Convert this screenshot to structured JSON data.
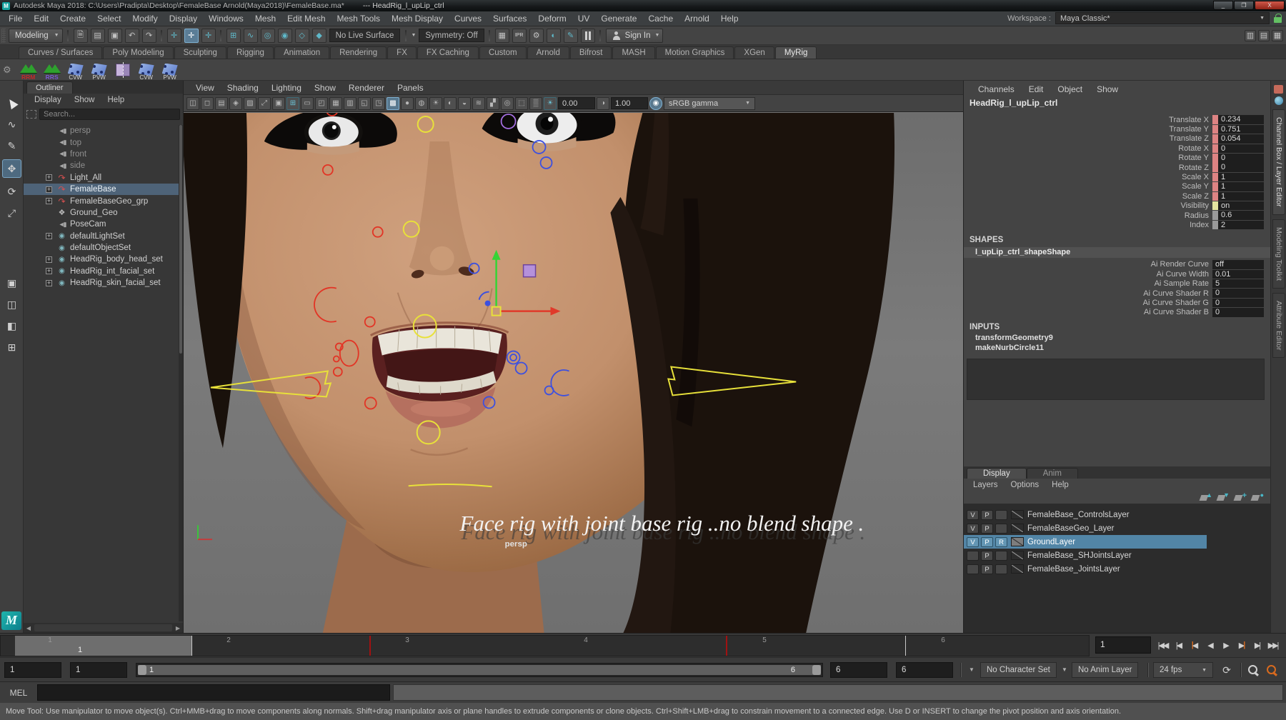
{
  "window": {
    "title": "Autodesk Maya 2018: C:\\Users\\Pradipta\\Desktop\\FemaleBase Arnold(Maya2018)\\FemaleBase.ma*",
    "title_extra": "---    HeadRig_l_upLip_ctrl",
    "buttons": {
      "minimize": "_",
      "restore": "❐",
      "close": "X"
    }
  },
  "menu_bar": {
    "items": [
      "File",
      "Edit",
      "Create",
      "Select",
      "Modify",
      "Display",
      "Windows",
      "Mesh",
      "Edit Mesh",
      "Mesh Tools",
      "Mesh Display",
      "Curves",
      "Surfaces",
      "Deform",
      "UV",
      "Generate",
      "Cache",
      "Arnold",
      "Help"
    ],
    "workspace_label": "Workspace :",
    "workspace_value": "Maya Classic*"
  },
  "status_line": {
    "menu_set": "Modeling",
    "live_surface": "No Live Surface",
    "symmetry": "Symmetry: Off",
    "ipr_label": "IPR",
    "sign_in": "Sign In"
  },
  "shelf": {
    "tabs": [
      "Curves / Surfaces",
      "Poly Modeling",
      "Sculpting",
      "Rigging",
      "Animation",
      "Rendering",
      "FX",
      "FX Caching",
      "Custom",
      "Arnold",
      "Bifrost",
      "MASH",
      "Motion Graphics",
      "XGen"
    ],
    "active_tab": "MyRig",
    "items": [
      {
        "label": "RRM"
      },
      {
        "label": "RRS"
      },
      {
        "label": "CVW"
      },
      {
        "label": "PVW"
      },
      {
        "label": ""
      },
      {
        "label": "CVW"
      },
      {
        "label": "PVW"
      }
    ]
  },
  "outliner": {
    "tab": "Outliner",
    "menus": [
      "Display",
      "Show",
      "Help"
    ],
    "search_placeholder": "Search...",
    "items": [
      {
        "label": "persp",
        "icon": "camera",
        "muted": true
      },
      {
        "label": "top",
        "icon": "camera",
        "muted": true
      },
      {
        "label": "front",
        "icon": "camera",
        "muted": true
      },
      {
        "label": "side",
        "icon": "camera",
        "muted": true
      },
      {
        "label": "Light_All",
        "icon": "transform",
        "expandable": true
      },
      {
        "label": "FemaleBase",
        "icon": "transform",
        "expandable": true,
        "selected": true
      },
      {
        "label": "FemaleBaseGeo_grp",
        "icon": "transform",
        "expandable": true
      },
      {
        "label": "Ground_Geo",
        "icon": "geo"
      },
      {
        "label": "PoseCam",
        "icon": "camera"
      },
      {
        "label": "defaultLightSet",
        "icon": "set",
        "expandable": true
      },
      {
        "label": "defaultObjectSet",
        "icon": "set"
      },
      {
        "label": "HeadRig_body_head_set",
        "icon": "set",
        "expandable": true
      },
      {
        "label": "HeadRig_int_facial_set",
        "icon": "set",
        "expandable": true
      },
      {
        "label": "HeadRig_skin_facial_set",
        "icon": "set",
        "expandable": true
      }
    ]
  },
  "viewport": {
    "menus": [
      "View",
      "Shading",
      "Lighting",
      "Show",
      "Renderer",
      "Panels"
    ],
    "exposure": "0.00",
    "gamma": "1.00",
    "color_transform": "sRGB gamma",
    "overlay_text": "Face rig  with joint base rig ..no blend shape .",
    "camera_label": "persp"
  },
  "channel_box": {
    "menus": [
      "Channels",
      "Edit",
      "Object",
      "Show"
    ],
    "object_name": "HeadRig_l_upLip_ctrl",
    "attributes": [
      {
        "label": "Translate X",
        "value": "0.234",
        "chip": "keyed"
      },
      {
        "label": "Translate Y",
        "value": "0.751",
        "chip": "keyed"
      },
      {
        "label": "Translate Z",
        "value": "0.054",
        "chip": "keyed"
      },
      {
        "label": "Rotate X",
        "value": "0",
        "chip": "keyed"
      },
      {
        "label": "Rotate Y",
        "value": "0",
        "chip": "keyed"
      },
      {
        "label": "Rotate Z",
        "value": "0",
        "chip": "keyed"
      },
      {
        "label": "Scale X",
        "value": "1",
        "chip": "keyed"
      },
      {
        "label": "Scale Y",
        "value": "1",
        "chip": "keyed"
      },
      {
        "label": "Scale Z",
        "value": "1",
        "chip": "keyed"
      },
      {
        "label": "Visibility",
        "value": "on",
        "chip": "vis"
      },
      {
        "label": "Radius",
        "value": "0.6",
        "chip": "plain"
      },
      {
        "label": "Index",
        "value": "2",
        "chip": "plain"
      }
    ],
    "shapes_header": "SHAPES",
    "shape_node": "l_upLip_ctrl_shapeShape",
    "shape_attributes": [
      {
        "label": "Ai Render Curve",
        "value": "off"
      },
      {
        "label": "Ai Curve Width",
        "value": "0.01"
      },
      {
        "label": "Ai Sample Rate",
        "value": "5"
      },
      {
        "label": "Ai Curve Shader R",
        "value": "0"
      },
      {
        "label": "Ai Curve Shader G",
        "value": "0"
      },
      {
        "label": "Ai Curve Shader B",
        "value": "0"
      }
    ],
    "inputs_header": "INPUTS",
    "inputs": [
      "transformGeometry9",
      "makeNurbCircle11"
    ]
  },
  "layer_editor": {
    "tabs": {
      "display": "Display",
      "anim": "Anim"
    },
    "menus": [
      "Layers",
      "Options",
      "Help"
    ],
    "layers": [
      {
        "v": "V",
        "p": "P",
        "r": "",
        "name": "FemaleBase_ControlsLayer",
        "swatch": "empty"
      },
      {
        "v": "V",
        "p": "P",
        "r": "",
        "name": "FemaleBaseGeo_Layer",
        "swatch": "empty"
      },
      {
        "v": "V",
        "p": "P",
        "r": "R",
        "name": "GroundLayer",
        "selected": true,
        "swatch": "filled"
      },
      {
        "v": "",
        "p": "P",
        "r": "",
        "name": "FemaleBase_SHJointsLayer",
        "swatch": "empty"
      },
      {
        "v": "",
        "p": "P",
        "r": "",
        "name": "FemaleBase_JointsLayer",
        "swatch": "empty"
      }
    ]
  },
  "sidebar_tabs": {
    "channel_box": "Channel Box / Layer Editor",
    "modeling_toolkit": "Modeling Toolkit",
    "attribute_editor": "Attribute Editor"
  },
  "timeline": {
    "ticks": [
      "1",
      "2",
      "3",
      "4",
      "5",
      "6"
    ],
    "current_frame": "1",
    "current_frame_field": "1"
  },
  "range_slider": {
    "anim_start": "1",
    "play_start": "1",
    "range_label_start": "1",
    "range_label_end": "6",
    "play_end": "6",
    "anim_end": "6",
    "character_set": "No Character Set",
    "anim_layer": "No Anim Layer",
    "fps": "24 fps"
  },
  "command_line": {
    "label": "MEL"
  },
  "help_line": {
    "text": "Move Tool: Use manipulator to move object(s). Ctrl+MMB+drag to move components along normals. Shift+drag manipulator axis or plane handles to extrude components or clone objects. Ctrl+Shift+LMB+drag to constrain movement to a connected edge. Use D or INSERT to change the pivot position and axis orientation."
  },
  "colors": {
    "selection_blue": "#5285a6",
    "keyed_channel_chip": "#dd8383",
    "visibility_chip": "#e4e4a0",
    "nonkeyable_chip": "#9a9a9a",
    "close_button_red": "#b8342a",
    "timeline_key_red": "#a01212",
    "autokey_orange": "#d86a1e",
    "maya_teal": "#15a3a0"
  }
}
